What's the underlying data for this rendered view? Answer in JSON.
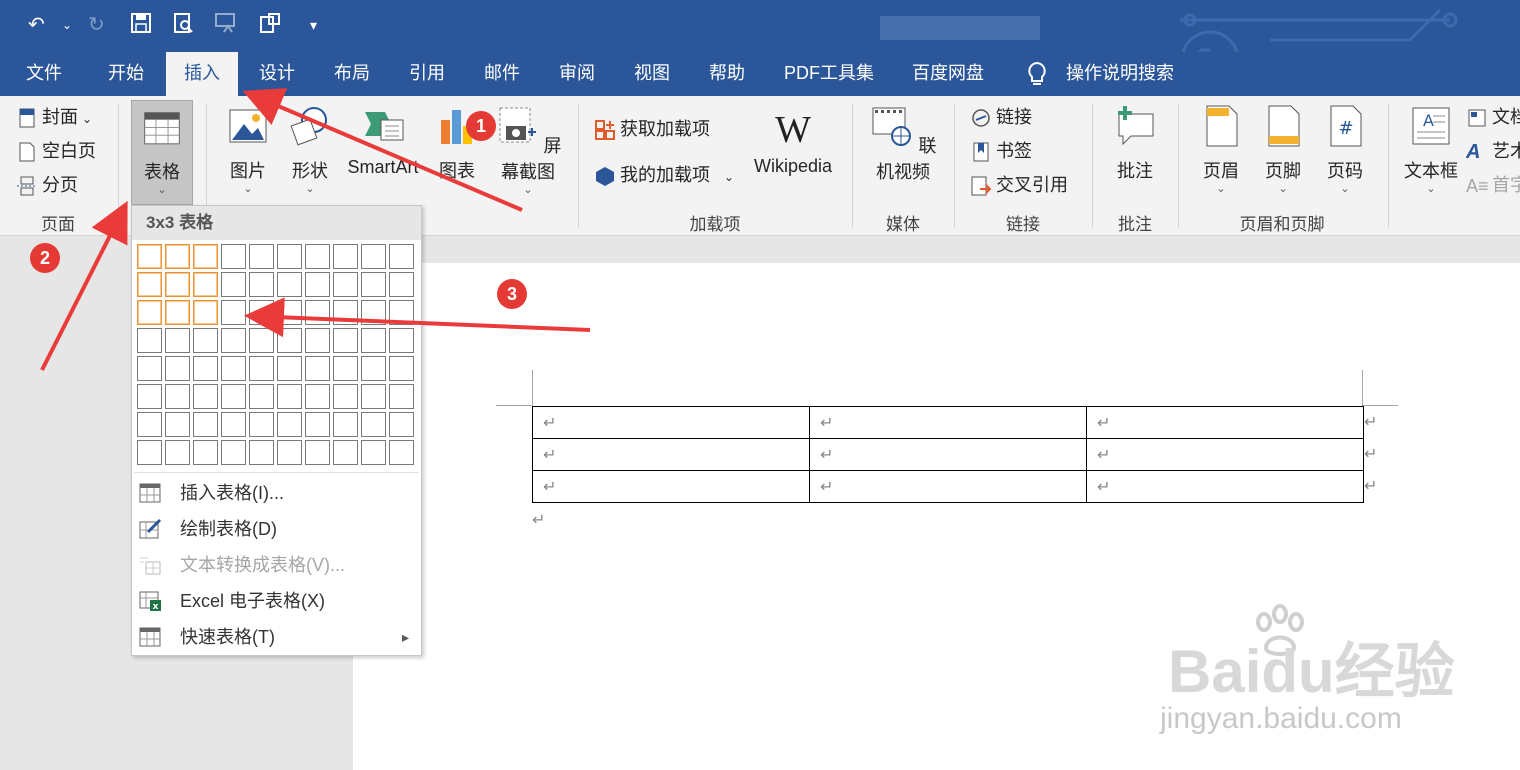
{
  "qat": {
    "undo_icon": "undo-icon",
    "redo_icon": "redo-icon",
    "save_icon": "save-icon",
    "preview_icon": "print-preview-icon",
    "touch_icon": "touch-mode-icon",
    "clipboard_icon": "clipboard-icon",
    "more_icon": "customize-qat-icon"
  },
  "tabs": [
    {
      "label": "文件"
    },
    {
      "label": "开始"
    },
    {
      "label": "插入"
    },
    {
      "label": "设计"
    },
    {
      "label": "布局"
    },
    {
      "label": "引用"
    },
    {
      "label": "邮件"
    },
    {
      "label": "审阅"
    },
    {
      "label": "视图"
    },
    {
      "label": "帮助"
    },
    {
      "label": "PDF工具集"
    },
    {
      "label": "百度网盘"
    },
    {
      "label": "操作说明搜索"
    }
  ],
  "ribbon": {
    "pages": {
      "cover": "封面",
      "blank": "空白页",
      "break": "分页",
      "label": "页面"
    },
    "table": {
      "label": "表格"
    },
    "illus": {
      "picture": "图片",
      "shapes": "形状",
      "smartart": "SmartArt",
      "chart": "图表",
      "screenshot": "屏幕截图"
    },
    "addins": {
      "get": "获取加载项",
      "my": "我的加载项",
      "wiki": "Wikipedia",
      "label": "加载项"
    },
    "media": {
      "video": "联机视频",
      "label": "媒体"
    },
    "links": {
      "link": "链接",
      "bookmark": "书签",
      "xref": "交叉引用",
      "label": "链接"
    },
    "comments": {
      "comment": "批注",
      "label": "批注"
    },
    "hf": {
      "header": "页眉",
      "footer": "页脚",
      "pagenum": "页码",
      "label": "页眉和页脚"
    },
    "text": {
      "textbox": "文本框",
      "doc": "文档",
      "wordart": "艺术",
      "dropcap": "首字"
    }
  },
  "dropdown": {
    "header": "3x3 表格",
    "grid": {
      "cols": 10,
      "rows": 8,
      "selected_cols": 3,
      "selected_rows": 3
    },
    "items": [
      {
        "label": "插入表格(I)...",
        "icon": "insert-table-icon",
        "disabled": false
      },
      {
        "label": "绘制表格(D)",
        "icon": "draw-table-icon",
        "disabled": false
      },
      {
        "label": "文本转换成表格(V)...",
        "icon": "convert-text-icon",
        "disabled": true
      },
      {
        "label": "Excel 电子表格(X)",
        "icon": "excel-sheet-icon",
        "disabled": false
      },
      {
        "label": "快速表格(T)",
        "icon": "quick-table-icon",
        "disabled": false,
        "submenu": "▸"
      }
    ]
  },
  "markers": {
    "m1": "1",
    "m2": "2",
    "m3": "3"
  },
  "doc": {
    "return_mark": "↵"
  },
  "watermark": {
    "brand": "Baidu经验",
    "url": "jingyan.baidu.com"
  },
  "colors": {
    "titlebar": "#2b579a",
    "marker": "#e53935",
    "arrow": "#ea3b3b",
    "selected_cell": "#e69138"
  }
}
